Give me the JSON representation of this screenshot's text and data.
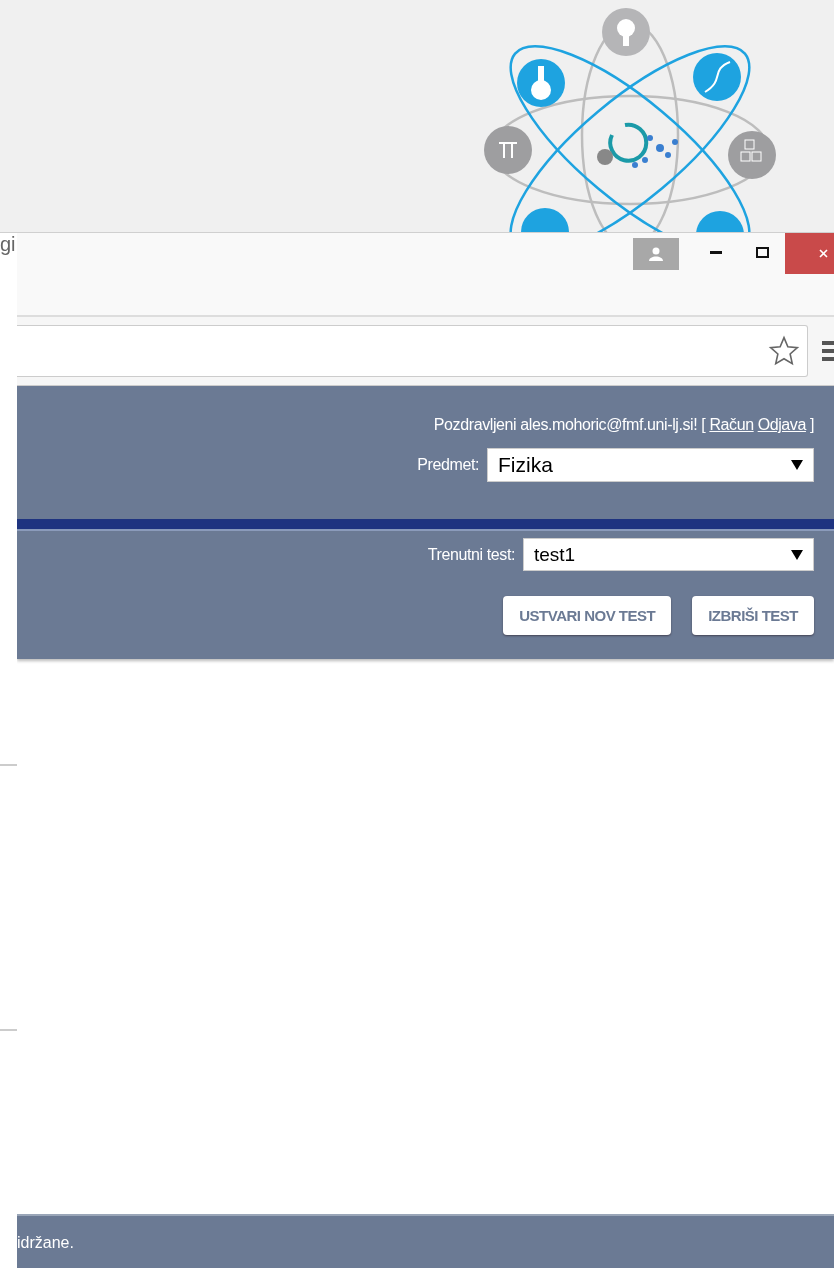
{
  "background_window": {
    "title_fragment": "gi"
  },
  "header": {
    "greeting": "Pozdravljeni ales.mohoric@fmf.uni-lj.si! [",
    "links": [
      "Račun",
      "Odjava"
    ],
    "greeting_end": "]"
  },
  "subject": {
    "label": "Predmet:",
    "value": "Fizika"
  },
  "current_test": {
    "label": "Trenutni test:",
    "value": "test1"
  },
  "buttons": [
    "USTVARI NOV TEST",
    "IZBRIŠI TEST"
  ],
  "footer": {
    "text": "idržane."
  }
}
